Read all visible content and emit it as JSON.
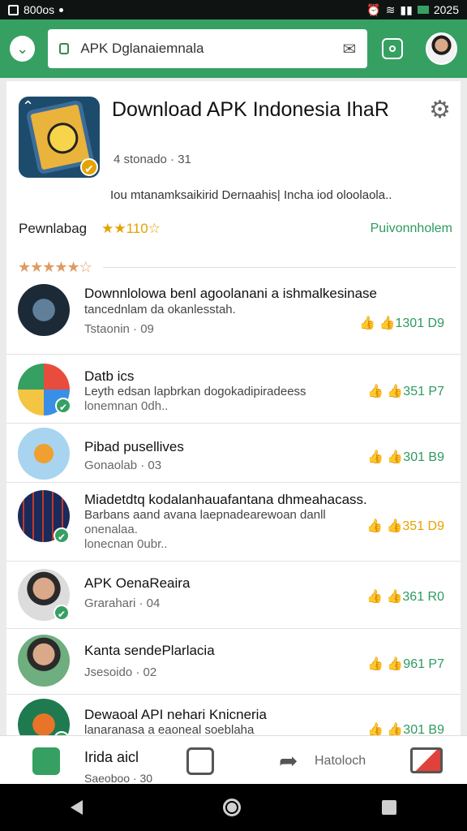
{
  "status_bar": {
    "left_text": "800os",
    "time": "2025"
  },
  "app_bar": {
    "search_value": "APK Dglanaiemnala"
  },
  "hero": {
    "title": "Download APK Indonesia IhaR",
    "subtitle": "4 stonado · 31",
    "description": "Iou mtanamksaikirid Dernaahis| Incha iod oloolaola..",
    "rating_label": "Pewnlabag",
    "rating_value": "★★110☆",
    "premium_label": "Puivonnholem",
    "stars": "★★★★★☆"
  },
  "items": [
    {
      "title": "Downnlolowa benl agoolanani a ishmalkesinase",
      "line2": "tancednlam da okanlesstah.",
      "meta": "Tstaonin · 09",
      "like": "👍 👍1301 D9"
    },
    {
      "title": "Datb ics",
      "line2": "Leyth edsan lapbrkan dogokadipiradeess",
      "line3": "lonemnan 0dh..",
      "like": "👍 👍351 P7"
    },
    {
      "title": "Pibad pusellives",
      "meta": "Gonaolab · 03",
      "like": "👍 👍301 B9"
    },
    {
      "title": "Miadetdtq kodalanhauafantana dhmeahacass.",
      "line2": "Barbans aand avana laepnadearewoan danll",
      "line3": "onenalaa.",
      "line4": "lonecnan 0ubr..",
      "like": "👍 👍351 D9"
    },
    {
      "title": "APK OenaReaira",
      "meta": "Grarahari · 04",
      "like": "👍 👍361 R0"
    },
    {
      "title": "Kanta sendePlarlacia",
      "meta": "Jsesoido · 02",
      "like": "👍 👍961 P7"
    },
    {
      "title": "Dewaoal API nehari Knicneria",
      "line2": "lanaranasa a eaoneal soeblaha",
      "like": "👍 👍301 B9"
    }
  ],
  "bottom_nav": {
    "label1": "Irida aicl",
    "sub1": "Saeoboo · 30",
    "label2": "Hatoloch"
  },
  "colors": {
    "brand": "#36a062",
    "accent": "#e5a200"
  }
}
